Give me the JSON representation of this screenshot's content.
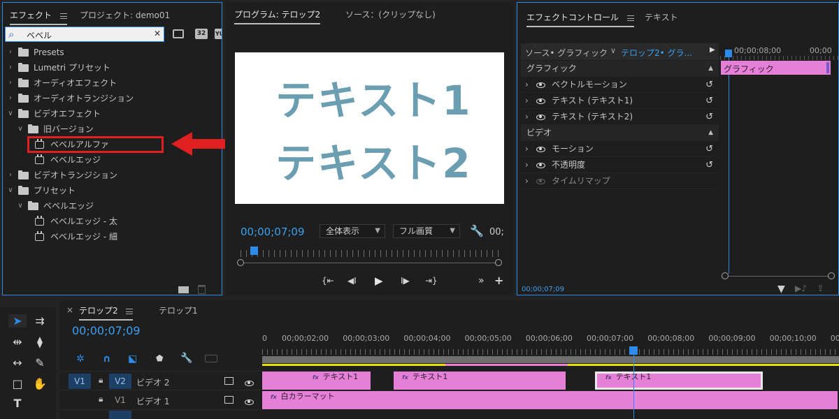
{
  "effects_panel": {
    "tab_effects": "エフェクト",
    "tab_project": "プロジェクト: demo01",
    "search_value": "ベベル",
    "search_clear": "✕",
    "search_icon_glyph": "⌕",
    "badge_32": "32",
    "badge_yuv": "YUV",
    "tree": [
      {
        "label": "Presets",
        "indent": 0,
        "expanded": false,
        "icon": "folder-star"
      },
      {
        "label": "Lumetri プリセット",
        "indent": 0,
        "expanded": false,
        "icon": "folder-star"
      },
      {
        "label": "オーディオエフェクト",
        "indent": 0,
        "expanded": false,
        "icon": "folder"
      },
      {
        "label": "オーディオトランジション",
        "indent": 0,
        "expanded": false,
        "icon": "folder"
      },
      {
        "label": "ビデオエフェクト",
        "indent": 0,
        "expanded": true,
        "icon": "folder"
      },
      {
        "label": "旧バージョン",
        "indent": 1,
        "expanded": true,
        "icon": "folder"
      },
      {
        "label": "ベベルアルファ",
        "indent": 2,
        "expanded": null,
        "icon": "effect",
        "highlight": true
      },
      {
        "label": "ベベルエッジ",
        "indent": 2,
        "expanded": null,
        "icon": "effect"
      },
      {
        "label": "ビデオトランジション",
        "indent": 0,
        "expanded": false,
        "icon": "folder"
      },
      {
        "label": "プリセット",
        "indent": 0,
        "expanded": true,
        "icon": "folder"
      },
      {
        "label": "ベベルエッジ",
        "indent": 1,
        "expanded": true,
        "icon": "folder-star"
      },
      {
        "label": "ベベルエッジ - 太",
        "indent": 2,
        "expanded": null,
        "icon": "preset"
      },
      {
        "label": "ベベルエッジ - 細",
        "indent": 2,
        "expanded": null,
        "icon": "preset"
      }
    ],
    "highlight_color": "#e02020"
  },
  "program_monitor": {
    "tab_program": "プログラム: テロップ2",
    "tab_source": "ソース：(クリップなし)",
    "text_line_1": "テキスト1",
    "text_line_2": "テキスト2",
    "text_color": "#6a9eb0",
    "timecode": "00;00;07;09",
    "zoom_select": "全体表示",
    "quality_select": "フル画質",
    "timecode_right": "00;",
    "playhead_fraction": 0.05
  },
  "effect_controls": {
    "tab_effect_controls": "エフェクトコントロール",
    "tab_text": "テキスト",
    "source_label": "ソース• グラフィック",
    "clip_label": "テロップ2• グラ...",
    "ruler_time_1": "00;00;08;00",
    "ruler_time_2": "00;00",
    "graphic_bar_label": "グラフィック",
    "rows": [
      {
        "label": "グラフィック",
        "type": "header"
      },
      {
        "label": "ベクトルモーション",
        "type": "item",
        "eye": true,
        "reset": true
      },
      {
        "label": "テキスト (テキスト1)",
        "type": "item",
        "eye": true,
        "reset": true
      },
      {
        "label": "テキスト (テキスト2)",
        "type": "item",
        "eye": true,
        "reset": true
      },
      {
        "label": "ビデオ",
        "type": "header"
      },
      {
        "label": "モーション",
        "type": "item",
        "eye": true,
        "reset": true
      },
      {
        "label": "不透明度",
        "type": "item",
        "eye": true,
        "reset": true
      },
      {
        "label": "タイムリマップ",
        "type": "item-dim",
        "eye": true,
        "reset": false
      }
    ],
    "bottom_timecode": "00;00;07;09"
  },
  "timeline": {
    "tab_active": "テロップ2",
    "tab_other": "テロップ1",
    "close_glyph": "×",
    "timecode": "00;00;07;09",
    "ruler": [
      "0",
      "00;00;02;00",
      "00;00;03;00",
      "00;00;04;00",
      "00;00;05;00",
      "00;00;06;00",
      "00;00;07;00",
      "00;00;08;00",
      "00;00;09;00",
      "00;00;10;00",
      "00;0"
    ],
    "tracks": [
      {
        "target": "V1",
        "lock": true,
        "id": "V2",
        "name": "ビデオ 2"
      },
      {
        "target": "",
        "lock": true,
        "id": "V1",
        "name": "ビデオ 1"
      }
    ],
    "clips_v2": [
      {
        "label": "テキスト1",
        "start": 0.0,
        "end": 0.19
      },
      {
        "label": "テキスト1",
        "start": 0.228,
        "end": 0.528
      },
      {
        "label": "テキスト1",
        "start": 0.577,
        "end": 0.87,
        "selected": true
      }
    ],
    "clip_v1": {
      "label": "白カラーマット",
      "start": 0.0,
      "end": 1.0
    },
    "clip_color": "#e57fd8",
    "playhead_color": "#2d8ceb"
  }
}
